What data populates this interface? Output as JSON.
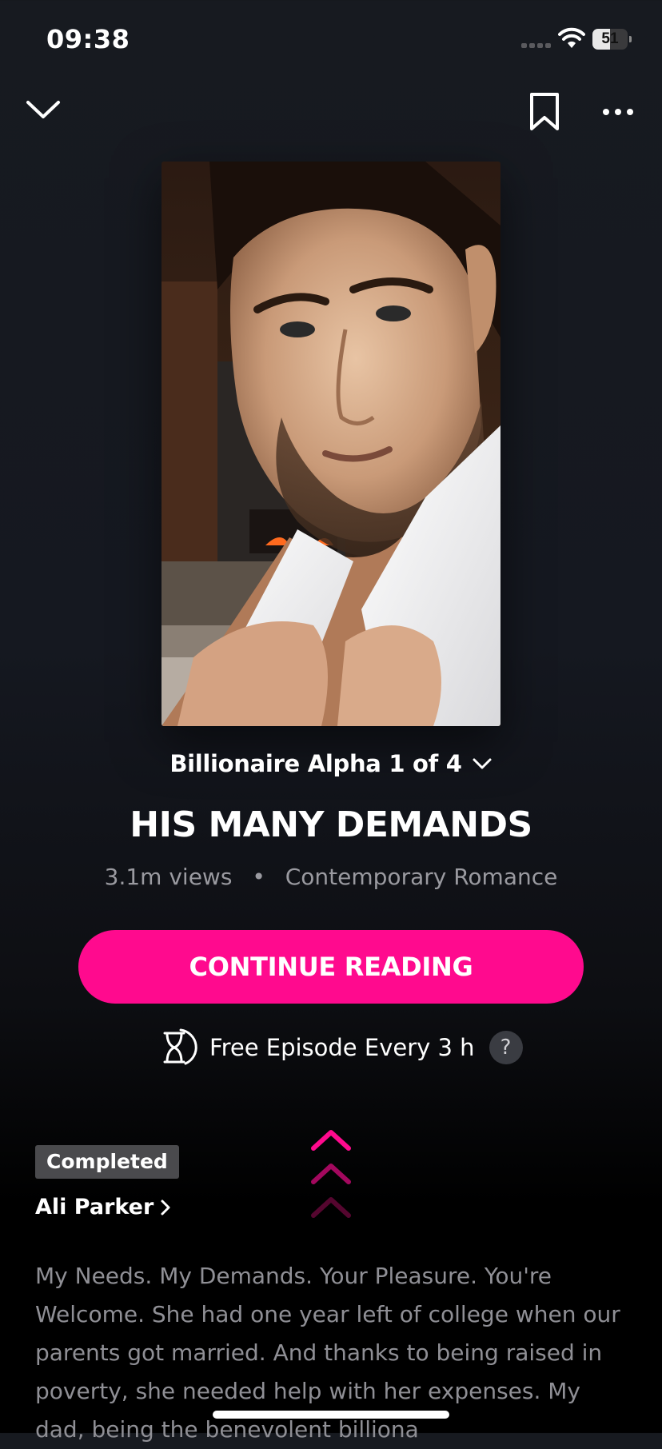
{
  "status_bar": {
    "time": "09:38",
    "battery_level": 51,
    "battery_text": "51",
    "icons": [
      "signal-icon",
      "wifi-icon",
      "battery-icon"
    ]
  },
  "nav": {
    "icons": [
      "chevron-down-icon",
      "bookmark-icon",
      "more-icon"
    ]
  },
  "book": {
    "series": "Billionaire Alpha 1 of 4",
    "title": "HIS MANY DEMANDS",
    "views": "3.1m views",
    "separator": "•",
    "genre": "Contemporary Romance",
    "cta_label": "CONTINUE READING",
    "free_episode": "Free Episode Every 3 h",
    "help": "?",
    "status_badge": "Completed",
    "author": "Ali Parker",
    "description": "My Needs. My Demands. Your Pleasure. You're Welcome. She had one year left of college when our parents got married. And thanks to being raised in poverty, she needed help with her expenses. My dad, being the benevolent billiona"
  },
  "colors": {
    "accent": "#ff0a8e",
    "background_top": "#171a20",
    "background_bottom": "#000000",
    "muted_text": "#9a9aa0",
    "badge_bg": "#4a4a4d"
  }
}
